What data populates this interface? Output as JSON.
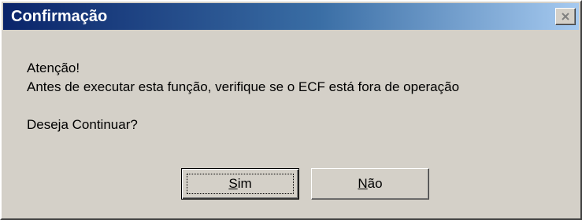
{
  "window": {
    "title": "Confirmação"
  },
  "message": {
    "line1": "Atenção!",
    "line2": "Antes de executar esta função, verifique se o ECF está fora de operação",
    "line3": "Deseja Continuar?"
  },
  "buttons": {
    "yes": {
      "mnemonic": "S",
      "rest": "im"
    },
    "no": {
      "mnemonic": "N",
      "rest": "ão"
    }
  },
  "icons": {
    "close": "close-icon"
  },
  "colors": {
    "titlebar_start": "#0a246a",
    "titlebar_end": "#a6caf0",
    "dialog_face": "#d4d0c8"
  }
}
